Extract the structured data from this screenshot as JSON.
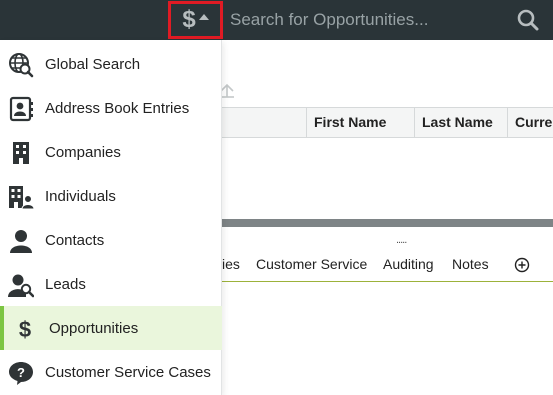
{
  "search": {
    "placeholder": "Search for Opportunities..."
  },
  "scope": {
    "icon": "dollar-icon",
    "caret": "caret-up-icon"
  },
  "menu": {
    "items": [
      {
        "label": "Global Search",
        "icon": "globe-search-icon"
      },
      {
        "label": "Address Book Entries",
        "icon": "address-book-icon"
      },
      {
        "label": "Companies",
        "icon": "building-icon"
      },
      {
        "label": "Individuals",
        "icon": "building-person-icon"
      },
      {
        "label": "Contacts",
        "icon": "person-icon"
      },
      {
        "label": "Leads",
        "icon": "person-search-icon"
      },
      {
        "label": "Opportunities",
        "icon": "dollar-icon",
        "active": true
      },
      {
        "label": "Customer Service Cases",
        "icon": "help-bubble-icon"
      }
    ]
  },
  "grid": {
    "columns": [
      "First Name",
      "Last Name",
      "Currer"
    ]
  },
  "tabs": {
    "items": [
      "ies",
      "Customer Service",
      "Auditing",
      "Notes"
    ]
  },
  "splitter_grip": ".....",
  "colors": {
    "topbar": "#2a3438",
    "highlight": "#e01b24",
    "active_bg": "#eaf6dc",
    "active_bar": "#7cc542",
    "tab_underline": "#9cb23a"
  }
}
